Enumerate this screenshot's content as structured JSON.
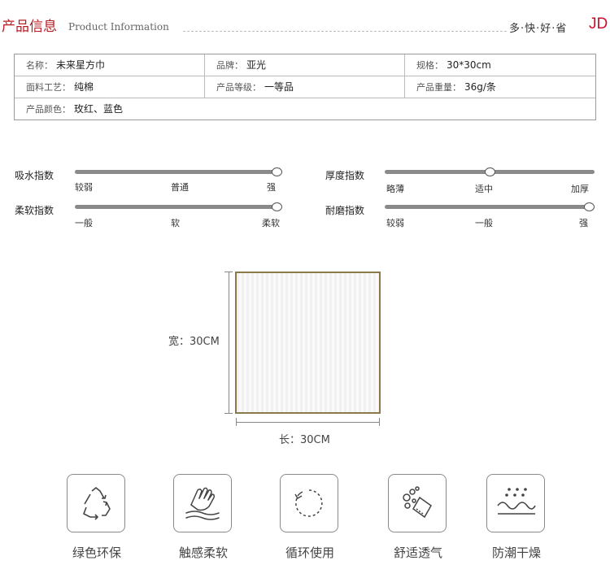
{
  "header": {
    "title": "产品信息",
    "subtitle": "Product Information",
    "slogan": "多·快·好·省",
    "brand": "JD"
  },
  "info": {
    "row1": [
      {
        "key": "名称：",
        "value": "未来星方巾"
      },
      {
        "key": "品牌：",
        "value": "亚光"
      },
      {
        "key": "规格：",
        "value": "30*30cm"
      }
    ],
    "row2": [
      {
        "key": "面料工艺：",
        "value": "纯棉"
      },
      {
        "key": "产品等级：",
        "value": "一等品"
      },
      {
        "key": "产品重量：",
        "value": "36g/条"
      }
    ],
    "row3": [
      {
        "key": "产品颜色：",
        "value": "玫红、蓝色"
      }
    ]
  },
  "indices": [
    {
      "label": "吸水指数",
      "ticks": [
        "较弱",
        "普通",
        "强"
      ],
      "level": 1.0
    },
    {
      "label": "柔软指数",
      "ticks": [
        "一般",
        "软",
        "柔软"
      ],
      "level": 1.0
    },
    {
      "label": "厚度指数",
      "ticks": [
        "略薄",
        "适中",
        "加厚"
      ],
      "level": 0.5
    },
    {
      "label": "耐磨指数",
      "ticks": [
        "较弱",
        "一般",
        "强"
      ],
      "level": 1.0
    }
  ],
  "dimensions": {
    "width_label": "宽：30CM",
    "length_label": "长：30CM"
  },
  "features": [
    {
      "label": "绿色环保",
      "icon": "recycle-icon"
    },
    {
      "label": "触感柔软",
      "icon": "hand-touch-icon"
    },
    {
      "label": "循环使用",
      "icon": "cycle-arrow-icon"
    },
    {
      "label": "舒适透气",
      "icon": "bubbles-icon"
    },
    {
      "label": "防潮干燥",
      "icon": "moisture-icon"
    }
  ],
  "colors": {
    "accent_red": "#b81c22",
    "jd_red": "#c8102e",
    "towel_border": "#8a7a4a"
  }
}
